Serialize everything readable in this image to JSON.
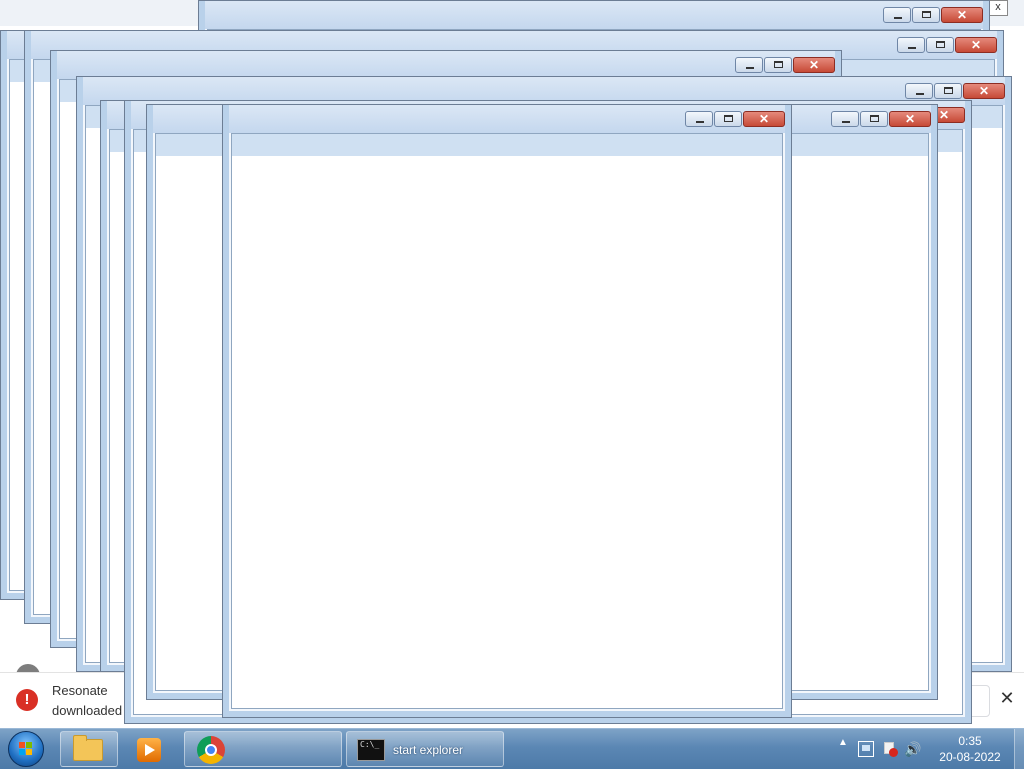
{
  "browser_background": {
    "download_bar": {
      "line1": "Resonate",
      "line2": "downloaded",
      "close_glyph": "✕",
      "error_icon": "error-icon",
      "error_color": "#d93025"
    }
  },
  "windows": {
    "count": 9,
    "caption": {
      "minimize": "—",
      "maximize": "□",
      "close": "✕"
    },
    "frame_color": "#b9d1ea",
    "close_color": "#c74a37"
  },
  "taskbar": {
    "pinned": [
      {
        "icon": "file-explorer-icon"
      },
      {
        "icon": "media-player-icon"
      },
      {
        "icon": "chrome-icon"
      }
    ],
    "running_task": {
      "icon": "command-prompt-icon",
      "label": "start  explorer",
      "icon_text": "C:\\_"
    },
    "tray": {
      "overflow_glyph": "▲",
      "volume_glyph": "🔊"
    },
    "clock": {
      "time": "0:35",
      "date": "20-08-2022"
    }
  }
}
